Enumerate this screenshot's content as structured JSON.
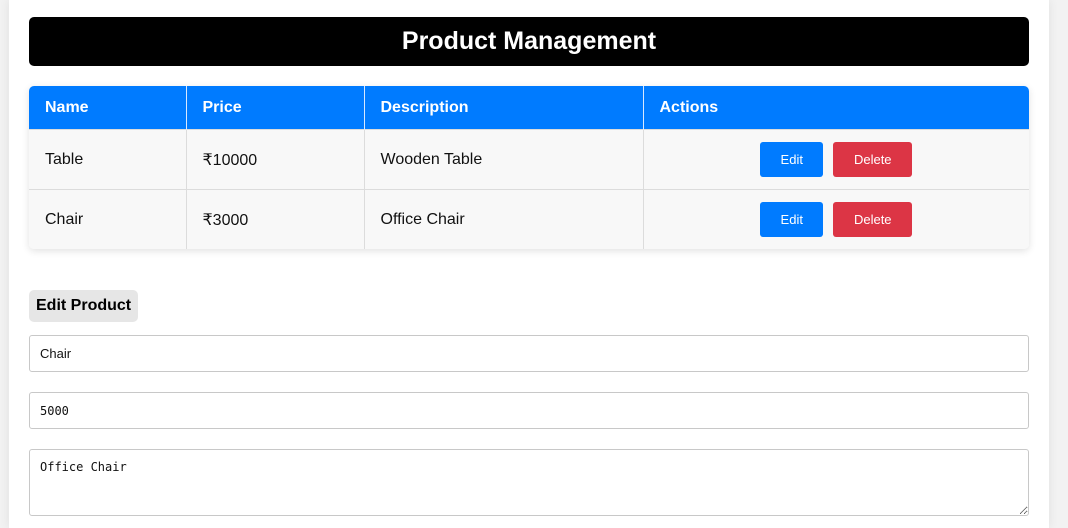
{
  "header": {
    "title": "Product Management"
  },
  "table": {
    "columns": [
      "Name",
      "Price",
      "Description",
      "Actions"
    ],
    "rows": [
      {
        "name": "Table",
        "price": "₹10000",
        "description": "Wooden Table",
        "edit_label": "Edit",
        "delete_label": "Delete"
      },
      {
        "name": "Chair",
        "price": "₹3000",
        "description": "Office Chair",
        "edit_label": "Edit",
        "delete_label": "Delete"
      }
    ]
  },
  "edit_form": {
    "heading": "Edit Product",
    "name_value": "Chair",
    "price_value": "5000",
    "description_value": "Office Chair"
  },
  "colors": {
    "header_bg": "#000000",
    "table_header_bg": "#007bff",
    "edit_button": "#007bff",
    "delete_button": "#dc3545"
  }
}
